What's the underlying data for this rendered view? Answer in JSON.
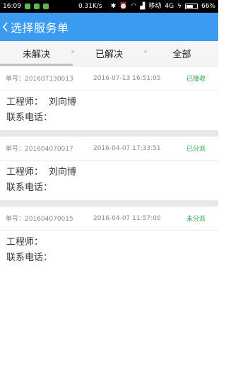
{
  "status_bar": {
    "time": "16:09",
    "speed": "0.31K/s",
    "carrier": "移动",
    "network": "4G",
    "battery": "66%",
    "battery_fraction": 0.66
  },
  "header": {
    "title": "选择服务单",
    "accent_color": "#3a9bf0"
  },
  "tabs": [
    {
      "label": "未解决",
      "active": true
    },
    {
      "label": "已解决",
      "active": false
    },
    {
      "label": "全部",
      "active": false
    }
  ],
  "labels": {
    "order_no": "单号：",
    "engineer": "工程师：",
    "phone": "联系电话："
  },
  "orders": [
    {
      "order_no": "201607130013",
      "time": "2016-07-13 16:51:05",
      "status": "已接收",
      "engineer": "刘向博",
      "phone": ""
    },
    {
      "order_no": "201604070017",
      "time": "2016-04-07 17:33:51",
      "status": "已分派",
      "engineer": "刘向博",
      "phone": ""
    },
    {
      "order_no": "201604070015",
      "time": "2016-04-07 11:57:00",
      "status": "未分派",
      "engineer": "",
      "phone": ""
    }
  ],
  "colors": {
    "status_green": "#2aa84a"
  }
}
